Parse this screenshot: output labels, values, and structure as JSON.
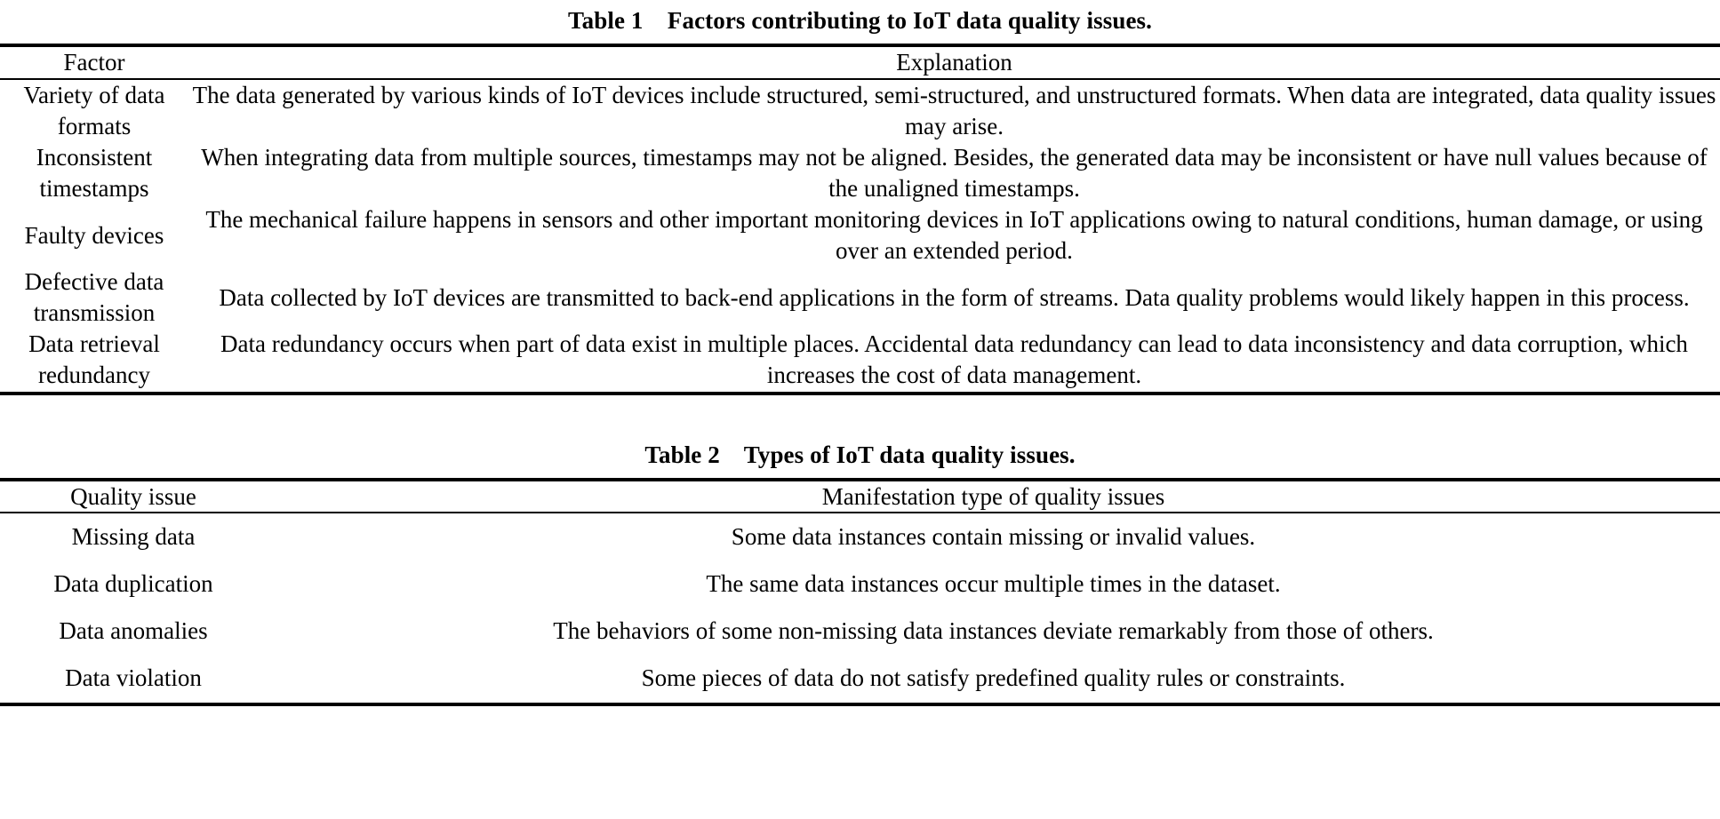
{
  "document": {
    "background_color": "#ffffff",
    "text_color": "#000000"
  },
  "table1": {
    "caption_label": "Table 1",
    "caption_text": "Factors contributing to IoT data quality issues.",
    "caption_full": "Table 1    Factors contributing to IoT data quality issues.",
    "columns": [
      "Factor",
      "Explanation"
    ],
    "rows": [
      {
        "factor": "Variety of data formats",
        "explanation": "The data generated by various kinds of IoT devices include structured, semi-structured, and unstructured formats. When data are integrated, data quality issues may arise."
      },
      {
        "factor": "Inconsistent timestamps",
        "explanation": "When integrating data from multiple sources, timestamps may not be aligned. Besides, the generated data may be inconsistent or have null values because of the unaligned timestamps."
      },
      {
        "factor": "Faulty devices",
        "explanation": "The mechanical failure happens in sensors and other important monitoring devices in IoT applications owing to natural conditions, human damage, or using over an extended period."
      },
      {
        "factor": "Defective data transmission",
        "explanation": "Data collected by IoT devices are transmitted to back-end applications in the form of streams. Data quality problems would likely happen in this process."
      },
      {
        "factor": "Data retrieval redundancy",
        "explanation": "Data redundancy occurs when part of data exist in multiple places. Accidental data redundancy can lead to data inconsistency and data corruption, which increases the cost of data management."
      }
    ]
  },
  "table2": {
    "caption_label": "Table 2",
    "caption_text": "Types of IoT data quality issues.",
    "caption_full": "Table 2    Types of IoT data quality issues.",
    "columns": [
      "Quality issue",
      "Manifestation type of quality issues"
    ],
    "rows": [
      {
        "issue": "Missing data",
        "manifestation": "Some data instances contain missing or invalid values."
      },
      {
        "issue": "Data duplication",
        "manifestation": "The same data instances occur multiple times in the dataset."
      },
      {
        "issue": "Data anomalies",
        "manifestation": "The behaviors of some non-missing data instances deviate remarkably from those of others."
      },
      {
        "issue": "Data violation",
        "manifestation": "Some pieces of data do not satisfy predefined quality rules or constraints."
      }
    ]
  }
}
